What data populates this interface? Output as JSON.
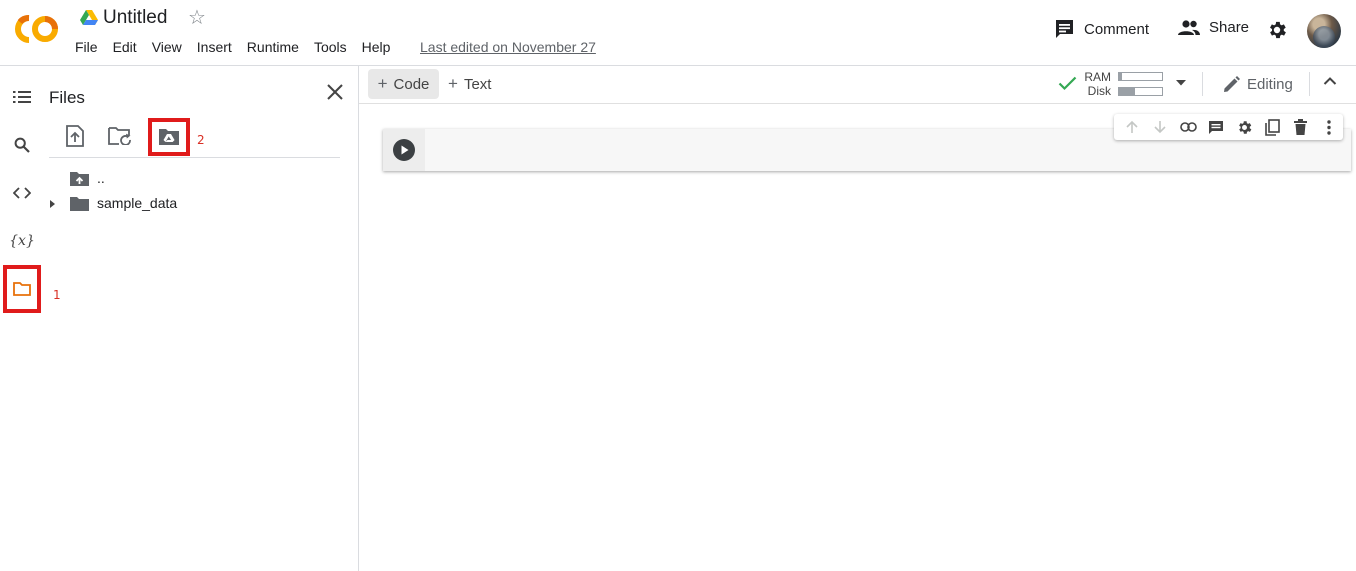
{
  "header": {
    "title": "Untitled",
    "menu": [
      "File",
      "Edit",
      "View",
      "Insert",
      "Runtime",
      "Tools",
      "Help"
    ],
    "last_edited": "Last edited on November 27",
    "comment_label": "Comment",
    "share_label": "Share"
  },
  "rail": {
    "items": [
      "table-of-contents-icon",
      "search-icon",
      "code-snippets-icon",
      "variables-icon",
      "files-icon"
    ],
    "variables_glyph": "{x}",
    "annotation_1": "1"
  },
  "files_panel": {
    "title": "Files",
    "tools": [
      "upload-icon",
      "refresh-folder-icon",
      "mount-drive-icon"
    ],
    "annotation_2": "2",
    "tree": [
      {
        "label": "..",
        "icon": "parent-folder-icon"
      },
      {
        "label": "sample_data",
        "icon": "folder-icon",
        "expandable": true
      }
    ]
  },
  "toolbar": {
    "code_label": "Code",
    "text_label": "Text",
    "ram_label": "RAM",
    "disk_label": "Disk",
    "ram_usage": 0.06,
    "disk_usage": 0.38,
    "editing_label": "Editing"
  },
  "colors": {
    "accent_red": "#e01b1b",
    "logo_orange": "#f9ab00",
    "logo_dark_orange": "#e8710a",
    "connected_green": "#34a853"
  }
}
